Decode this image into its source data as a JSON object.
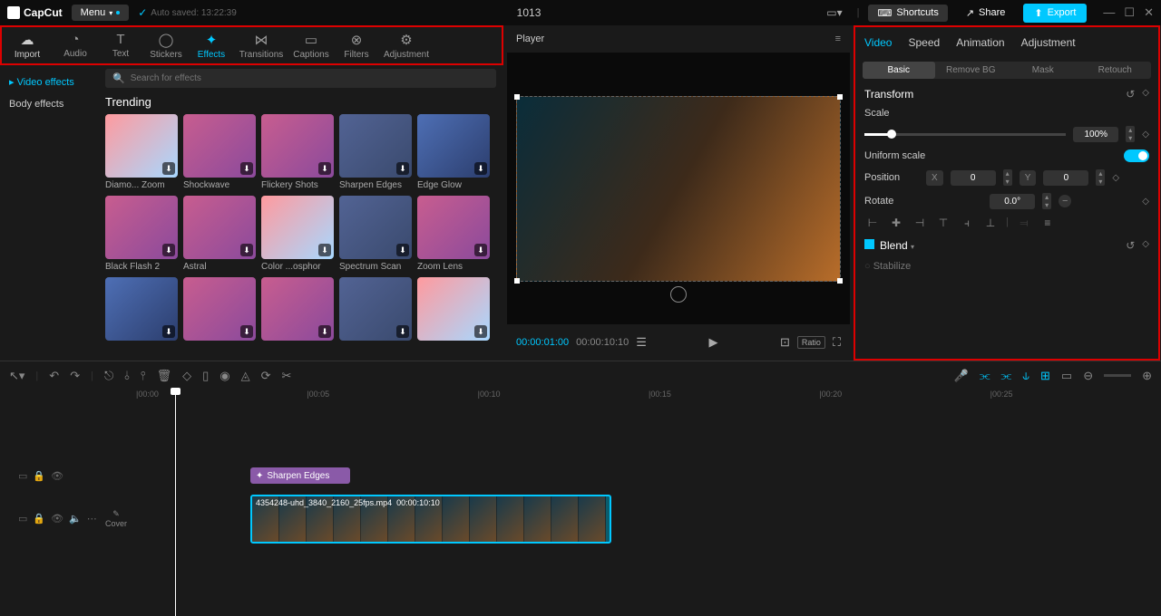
{
  "titlebar": {
    "app_name": "CapCut",
    "menu_label": "Menu",
    "autosaved_label": "Auto saved: 13:22:39",
    "project_title": "1013",
    "shortcuts_label": "Shortcuts",
    "share_label": "Share",
    "export_label": "Export"
  },
  "nav": {
    "import": "Import",
    "audio": "Audio",
    "text": "Text",
    "stickers": "Stickers",
    "effects": "Effects",
    "transitions": "Transitions",
    "captions": "Captions",
    "filters": "Filters",
    "adjustment": "Adjustment"
  },
  "sidebar": {
    "video_effects": "Video effects",
    "body_effects": "Body effects"
  },
  "search": {
    "placeholder": "Search for effects"
  },
  "effects": {
    "section_title": "Trending",
    "items": [
      {
        "label": "Diamo... Zoom",
        "variant": "v1"
      },
      {
        "label": "Shockwave",
        "variant": ""
      },
      {
        "label": "Flickery Shots",
        "variant": ""
      },
      {
        "label": "Sharpen Edges",
        "variant": "v2"
      },
      {
        "label": "Edge Glow",
        "variant": "v3"
      },
      {
        "label": "Black Flash 2",
        "variant": ""
      },
      {
        "label": "Astral",
        "variant": ""
      },
      {
        "label": "Color ...osphor",
        "variant": "v1"
      },
      {
        "label": "Spectrum Scan",
        "variant": "v2"
      },
      {
        "label": "Zoom Lens",
        "variant": ""
      },
      {
        "label": "",
        "variant": "v3"
      },
      {
        "label": "",
        "variant": ""
      },
      {
        "label": "",
        "variant": ""
      },
      {
        "label": "",
        "variant": "v2"
      },
      {
        "label": "",
        "variant": "v1"
      }
    ]
  },
  "player": {
    "label": "Player",
    "current_time": "00:00:01:00",
    "duration": "00:00:10:10",
    "ratio_label": "Ratio"
  },
  "inspector": {
    "tabs": {
      "video": "Video",
      "speed": "Speed",
      "animation": "Animation",
      "adjustment": "Adjustment"
    },
    "subtabs": {
      "basic": "Basic",
      "remove_bg": "Remove BG",
      "mask": "Mask",
      "retouch": "Retouch"
    },
    "transform_label": "Transform",
    "scale_label": "Scale",
    "scale_value": "100%",
    "uniform_label": "Uniform scale",
    "position_label": "Position",
    "pos_x_label": "X",
    "pos_x": "0",
    "pos_y_label": "Y",
    "pos_y": "0",
    "rotate_label": "Rotate",
    "rotate_value": "0.0°",
    "blend_label": "Blend",
    "stabilize_label": "Stabilize"
  },
  "timeline": {
    "marks": [
      "|00:00",
      "|00:05",
      "|00:10",
      "|00:15",
      "|00:20",
      "|00:25"
    ],
    "effect_clip_label": "Sharpen Edges",
    "clip_filename": "4354248-uhd_3840_2160_25fps.mp4",
    "clip_time": "00:00:10:10",
    "cover_label": "Cover"
  }
}
